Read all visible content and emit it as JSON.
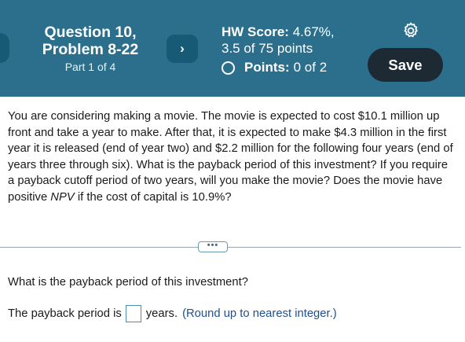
{
  "header": {
    "question_title": "Question 10,",
    "problem_title": "Problem 8-22",
    "part": "Part 1 of 4",
    "next_icon": "chevron-right-icon",
    "hw_score_label": "HW Score:",
    "hw_score_value": "4.67%,",
    "score_points": "3.5 of 75 points",
    "points_label": "Points:",
    "points_value": "0 of 2",
    "settings_icon": "gear-icon",
    "save_label": "Save",
    "colors": {
      "header_bg": "#2b6f8d",
      "nav_bg": "#175a76",
      "save_bg": "#1d2a33"
    }
  },
  "question": {
    "text_1": "You are considering making a movie. The movie is expected to cost $10.1 million up front and take a year to make. After that, it is expected to make $4.3 million in the first year it is released (end of year two) and $2.2 million for the following four years (end of years three through six). What is the payback period of this investment? If you require a payback cutoff period of two years, will you make the movie? Does the movie have positive ",
    "npv_term": "NPV",
    "text_2": " if the cost of capital is 10.9%?"
  },
  "expand": {
    "label": "•••"
  },
  "part1": {
    "prompt": "What is the payback period of this investment?",
    "answer_prefix": "The payback period is",
    "answer_value": "",
    "answer_suffix": "years.",
    "hint": "(Round up to nearest integer.)"
  }
}
